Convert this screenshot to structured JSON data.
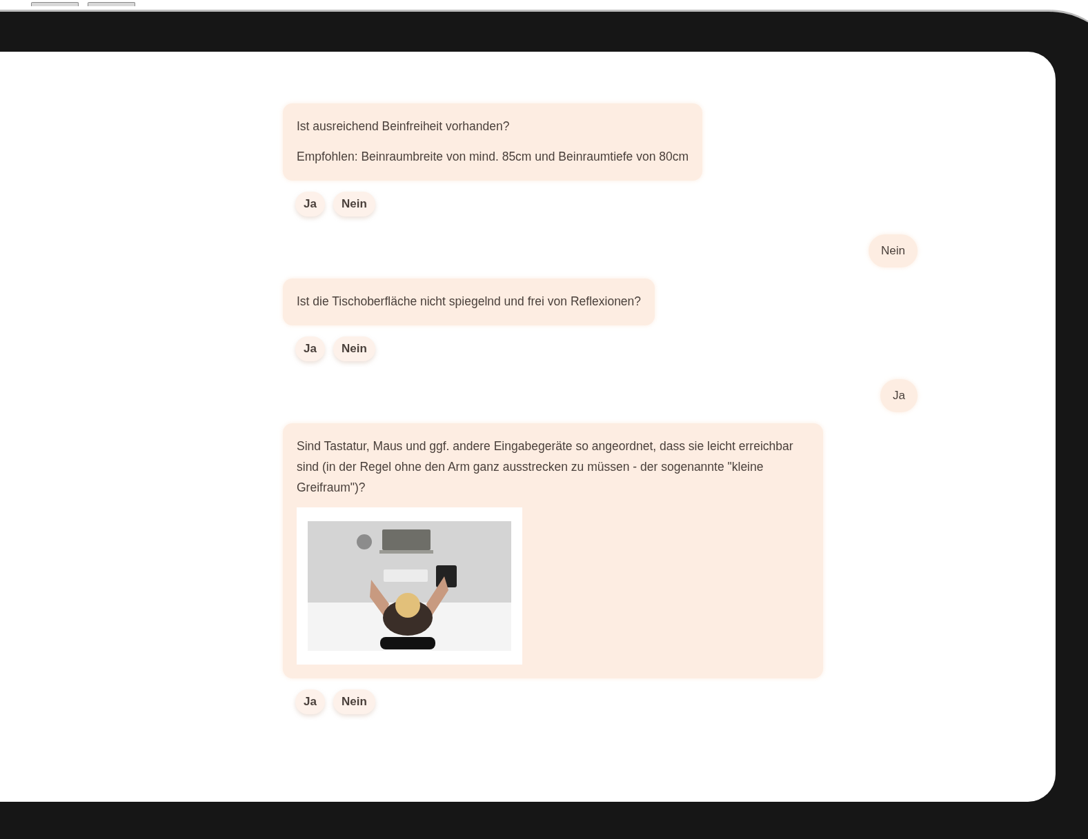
{
  "messages": [
    {
      "kind": "bot",
      "paragraphs": [
        "Ist ausreichend Beinfreiheit vorhanden?",
        "Empfohlen: Beinraumbreite von mind. 85cm und Beinraumtiefe von 80cm"
      ],
      "options": [
        "Ja",
        "Nein"
      ]
    },
    {
      "kind": "user",
      "text": "Nein"
    },
    {
      "kind": "bot",
      "paragraphs": [
        "Ist die Tischoberfläche nicht spiegelnd und frei von Reflexionen?"
      ],
      "options": [
        "Ja",
        "Nein"
      ]
    },
    {
      "kind": "user",
      "text": "Ja"
    },
    {
      "kind": "bot",
      "paragraphs": [
        "Sind Tastatur, Maus und ggf. andere Eingabegeräte so angeordnet, dass sie leicht erreichbar sind (in der Regel ohne den Arm ganz ausstrecken zu müssen - der sogenannte \"kleine Greifraum\")?"
      ],
      "image": {
        "kind": "picture"
      },
      "options": [
        "Ja",
        "Nein"
      ]
    }
  ]
}
